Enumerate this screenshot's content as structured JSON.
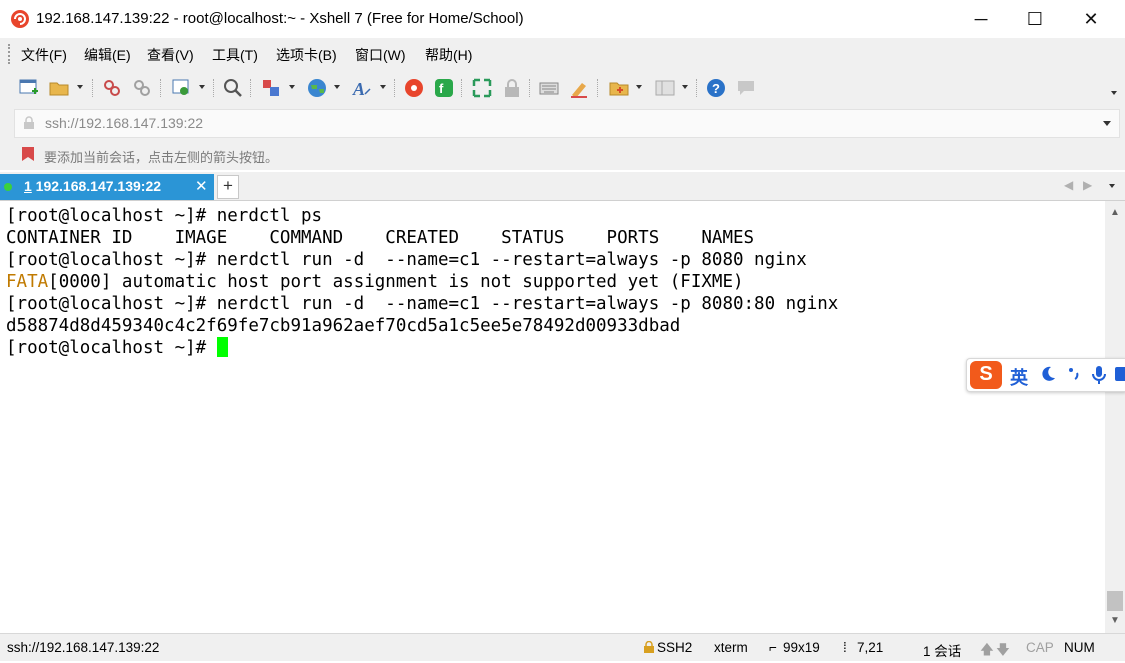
{
  "window": {
    "title": "192.168.147.139:22 - root@localhost:~ - Xshell 7 (Free for Home/School)",
    "minimize_label": "─",
    "maximize_label": "☐",
    "close_label": "✕"
  },
  "menu": {
    "items": [
      "文件(F)",
      "编辑(E)",
      "查看(V)",
      "工具(T)",
      "选项卡(B)",
      "窗口(W)",
      "帮助(H)"
    ]
  },
  "toolbar": {
    "icons": [
      "new-session-icon",
      "open-folder-icon",
      "disconnect-icon",
      "reconnect-icon",
      "properties-icon",
      "find-icon",
      "transfer-icon",
      "globe-icon",
      "font-icon",
      "xshell-icon",
      "xftp-icon",
      "fullscreen-icon",
      "lock-icon",
      "keyboard-icon",
      "highlight-icon",
      "add-folder-icon",
      "layout-icon",
      "help-icon",
      "chat-icon"
    ]
  },
  "address": {
    "value": "ssh://192.168.147.139:22"
  },
  "hint": {
    "text": "要添加当前会话，点击左侧的箭头按钮。"
  },
  "tabs": {
    "active_number": "1",
    "active_label": " 192.168.147.139:22",
    "close": "✕",
    "new_tab": "+",
    "prev": "◀",
    "next": "▶"
  },
  "terminal": {
    "lines": [
      "[root@localhost ~]# nerdctl ps",
      "CONTAINER ID    IMAGE    COMMAND    CREATED    STATUS    PORTS    NAMES",
      "[root@localhost ~]# nerdctl run -d  --name=c1 --restart=always -p 8080 nginx",
      "[0000] automatic host port assignment is not supported yet (FIXME)",
      "[root@localhost ~]# nerdctl run -d  --name=c1 --restart=always -p 8080:80 nginx",
      "d58874d8d459340c4c2f69fe7cb91a962aef70cd5a1c5ee5e78492d00933dbad",
      "[root@localhost ~]# "
    ],
    "fata_prefix": "FATA"
  },
  "ime": {
    "logo": "S",
    "mode": "英"
  },
  "status": {
    "address": "ssh://192.168.147.139:22",
    "protocol": "SSH2",
    "term": "xterm",
    "size": "99x19",
    "cursor_pos": "7,21",
    "sessions": "1 会话",
    "cap": "CAP",
    "num": "NUM"
  },
  "colors": {
    "tab_active": "#2b95d6",
    "cursor": "#00ff00",
    "fata": "#c07a00",
    "ime_logo": "#f25a1b"
  }
}
